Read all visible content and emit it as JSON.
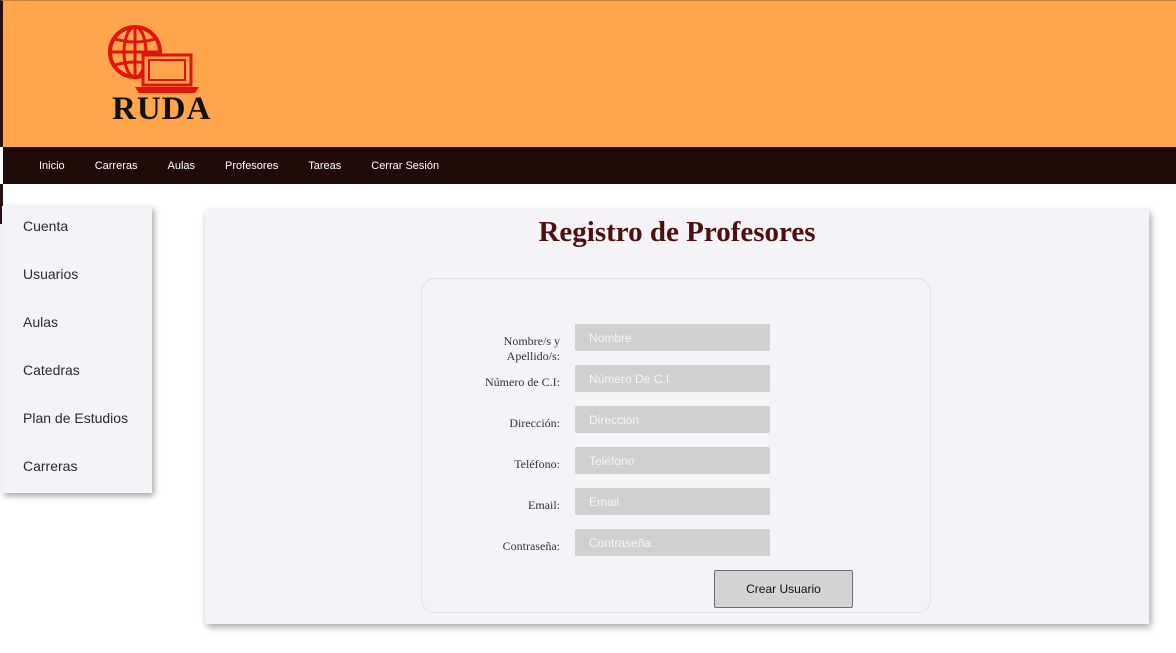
{
  "brand": {
    "logo_text": "RUDA",
    "colors": {
      "header": "#ffa54c",
      "navbar": "#1f0b0a",
      "logo_red": "#e0140f",
      "title": "#4d0f0f",
      "input_bg": "#d0d0d0"
    }
  },
  "nav": {
    "items": [
      {
        "label": "Inicio"
      },
      {
        "label": "Carreras"
      },
      {
        "label": "Aulas"
      },
      {
        "label": "Profesores"
      },
      {
        "label": "Tareas"
      },
      {
        "label": "Cerrar Sesión"
      }
    ]
  },
  "sidebar": {
    "items": [
      {
        "label": "Cuenta"
      },
      {
        "label": "Usuarios"
      },
      {
        "label": "Aulas"
      },
      {
        "label": "Catedras"
      },
      {
        "label": "Plan de Estudios"
      },
      {
        "label": "Carreras"
      }
    ]
  },
  "main": {
    "title": "Registro de Profesores",
    "form": {
      "fields": [
        {
          "label": "Nombre/s y Apellido/s:",
          "placeholder": "Nombre",
          "value": ""
        },
        {
          "label": "Número de C.I:",
          "placeholder": "Número De C.I",
          "value": ""
        },
        {
          "label": "Dirección:",
          "placeholder": "Dirección",
          "value": ""
        },
        {
          "label": "Teléfono:",
          "placeholder": "Teléfono",
          "value": ""
        },
        {
          "label": "Email:",
          "placeholder": "Email",
          "value": ""
        },
        {
          "label": "Contraseña:",
          "placeholder": "Contraseña",
          "value": ""
        }
      ],
      "submit_label": "Crear Usuario"
    }
  }
}
